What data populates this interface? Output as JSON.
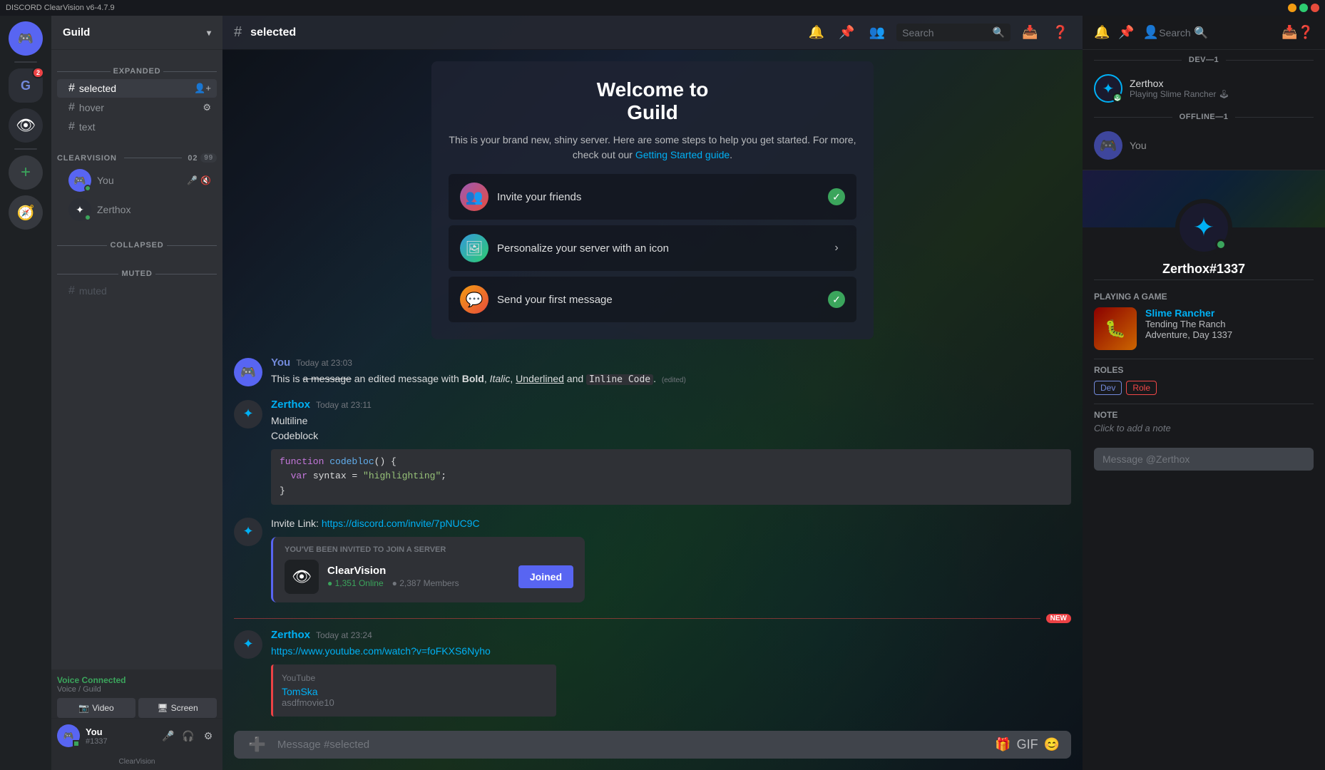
{
  "app": {
    "title": "DISCORD ClearVision v6-4.7.9"
  },
  "titlebar": {
    "minimize": "─",
    "maximize": "□",
    "close": "✕"
  },
  "server_list": {
    "discord_home_icon": "💬",
    "guild_server": "G",
    "clearvision_server": "👁",
    "add_server": "+",
    "explore": "🧭"
  },
  "sidebar": {
    "server_name": "Guild",
    "expanded_label": "EXPANDED",
    "selected_channel": "selected",
    "hover_channel": "hover",
    "text_channel": "text",
    "clearvision_category": "ClearVision",
    "clearvision_badge1": "02",
    "clearvision_badge2": "99",
    "you_member": "You",
    "zerthox_member": "Zerthox",
    "collapsed_label": "COLLAPSED",
    "muted_label": "MUTED",
    "muted_channel": "muted"
  },
  "voice": {
    "status": "Voice Connected",
    "location": "Voice / Guild",
    "video_label": "Video",
    "screen_label": "Screen"
  },
  "user_panel": {
    "username": "You",
    "tag": "#1337",
    "server_label": "ClearVision"
  },
  "channel_header": {
    "hash": "#",
    "channel_name": "selected",
    "search_placeholder": "Search"
  },
  "welcome": {
    "title": "Welcome to\nGuild",
    "subtitle": "This is your brand new, shiny server. Here are some steps to help you get started. For more, check out our",
    "link_text": "Getting Started guide",
    "checklist": [
      {
        "label": "Invite your friends",
        "done": true
      },
      {
        "label": "Personalize your server with an icon",
        "done": false,
        "arrow": true
      },
      {
        "label": "Send your first message",
        "done": true
      }
    ]
  },
  "messages": [
    {
      "id": "msg1",
      "author": "You",
      "author_class": "you-name",
      "timestamp": "Today at 23:03",
      "parts": [
        {
          "type": "text",
          "content": "This is "
        },
        {
          "type": "strike",
          "content": "a message"
        },
        {
          "type": "text",
          "content": " an edited message with "
        },
        {
          "type": "bold",
          "content": "Bold"
        },
        {
          "type": "text",
          "content": ", "
        },
        {
          "type": "italic",
          "content": "Italic"
        },
        {
          "type": "text",
          "content": ", "
        },
        {
          "type": "underline",
          "content": "Underlined"
        },
        {
          "type": "text",
          "content": " and "
        },
        {
          "type": "code",
          "content": "Inline Code"
        },
        {
          "type": "text",
          "content": ". "
        },
        {
          "type": "edited",
          "content": "(edited)"
        }
      ]
    },
    {
      "id": "msg2",
      "author": "Zerthox",
      "author_class": "",
      "timestamp": "Today at 23:11",
      "text_lines": [
        "Multiline",
        "Codeblock"
      ],
      "code_block": {
        "lines": [
          {
            "type": "keyword",
            "content": "function "
          },
          {
            "type": "func",
            "content": "codebloc"
          },
          {
            "type": "normal",
            "content": "() {"
          },
          {
            "type": "indent_var",
            "content": "  var syntax = "
          },
          {
            "type": "str",
            "content": "\"highlighting\""
          },
          {
            "type": "normal",
            "content": ";"
          },
          {
            "type": "normal",
            "content": "}"
          }
        ]
      }
    },
    {
      "id": "msg3",
      "author": "Zerthox",
      "author_class": "",
      "timestamp": "Today at 23:11",
      "link_text": "Invite Link: ",
      "invite_link": "https://discord.com/invite/7pNUC9C",
      "embed": {
        "header": "YOU'VE BEEN INVITED TO JOIN A SERVER",
        "server_name": "ClearVision",
        "online": "1,351 Online",
        "members": "2,387 Members",
        "join_label": "Joined"
      }
    }
  ],
  "new_messages_divider": "NEW",
  "recent_messages": [
    {
      "id": "msg4",
      "author": "Zerthox",
      "timestamp": "Today at 23:24",
      "link": "https://www.youtube.com/watch?v=foFKXS6Nyho",
      "yt_label": "YouTube",
      "yt_title": "TomSka",
      "yt_sub": "asdfmovie10"
    }
  ],
  "message_input": {
    "placeholder": "Message #selected"
  },
  "right_panel": {
    "dev_section": "DEV—1",
    "offline_section": "OFFLINE—1",
    "zerthox_name": "Zerthox",
    "zerthox_activity": "Playing Slime Rancher 🕹",
    "you_name": "You",
    "profile": {
      "username": "Zerthox#1337",
      "playing_label": "PLAYING A GAME",
      "game_name": "Slime Rancher",
      "game_desc1": "Tending The Ranch",
      "game_desc2": "Adventure, Day 1337",
      "roles_label": "ROLES",
      "role1": "Dev",
      "role2": "Role",
      "note_label": "NOTE",
      "note_text": "Click to add a note",
      "dm_placeholder": "Message @Zerthox"
    }
  }
}
